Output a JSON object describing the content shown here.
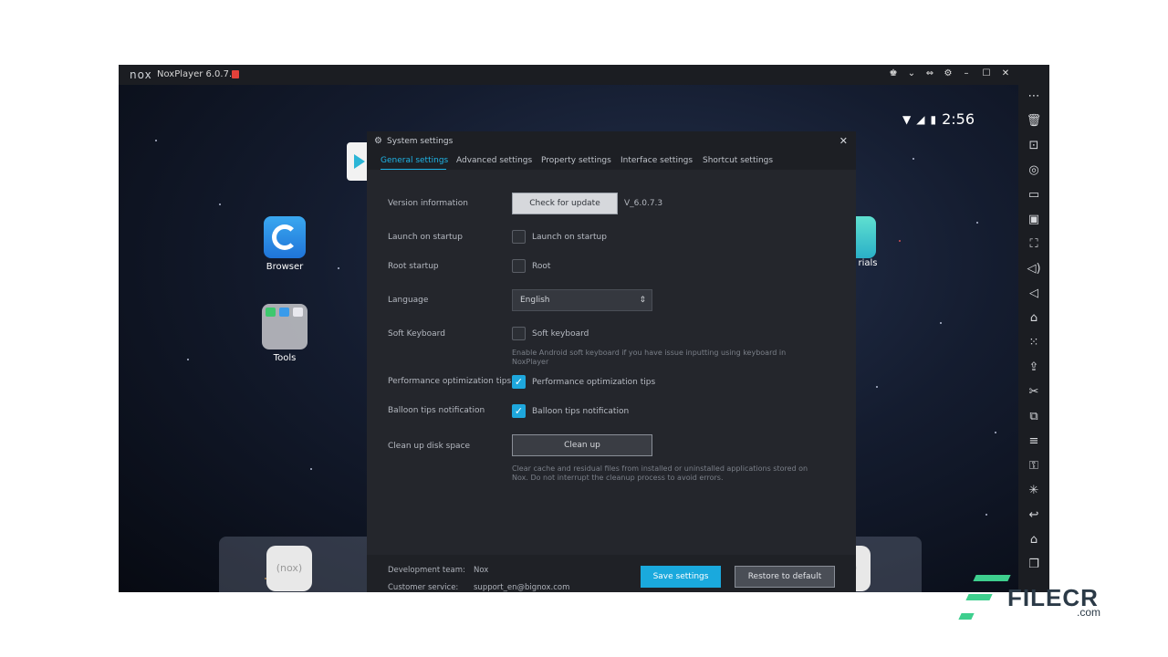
{
  "window": {
    "logo": "nox",
    "title": "NoxPlayer 6.0.7.3",
    "controls": [
      "♚",
      "⌄",
      "⇔",
      "⚙",
      "–",
      "☐",
      "✕"
    ]
  },
  "status_bar": {
    "time": "2:56"
  },
  "home": {
    "apps": [
      {
        "label": "Browser"
      },
      {
        "label": "Tools"
      },
      {
        "label": "rials"
      }
    ],
    "dock": {
      "nox_label": "(nox)"
    }
  },
  "dialog": {
    "title": "System settings",
    "tabs": [
      "General settings",
      "Advanced settings",
      "Property settings",
      "Interface settings",
      "Shortcut settings"
    ],
    "active_tab": "General settings",
    "rows": {
      "version": {
        "label": "Version information",
        "button": "Check for update",
        "value": "V_6.0.7.3"
      },
      "launch": {
        "label": "Launch on startup",
        "checkbox": "Launch on startup",
        "checked": false
      },
      "root": {
        "label": "Root startup",
        "checkbox": "Root",
        "checked": false
      },
      "language": {
        "label": "Language",
        "value": "English"
      },
      "keyboard": {
        "label": "Soft Keyboard",
        "checkbox": "Soft keyboard",
        "checked": false,
        "hint": "Enable Android soft keyboard if you have issue inputting using keyboard in NoxPlayer"
      },
      "perf": {
        "label": "Performance optimization tips",
        "checkbox": "Performance optimization tips",
        "checked": true
      },
      "balloon": {
        "label": "Balloon tips notification",
        "checkbox": "Balloon tips notification",
        "checked": true
      },
      "cleanup": {
        "label": "Clean up disk space",
        "button": "Clean up",
        "hint": "Clear cache and residual files from installed or uninstalled applications stored on Nox. Do not interrupt the cleanup process to avoid errors."
      }
    },
    "footer": {
      "dev_label": "Development team:",
      "dev_value": "Nox",
      "support_label": "Customer service:",
      "support_value": "support_en@bignox.com",
      "save": "Save settings",
      "restore": "Restore to default"
    }
  },
  "sidebar_icons": [
    "more-icon",
    "trash-icon",
    "robot-icon",
    "location-icon",
    "screen-icon",
    "apk-icon",
    "fullscreen-icon",
    "volume-up-icon",
    "volume-down-icon",
    "toolbox-icon",
    "shake-icon",
    "upload-icon",
    "scissors-icon",
    "multi-instance-icon",
    "menu-icon",
    "key-icon",
    "loading-icon",
    "back-icon",
    "home-icon",
    "recent-icon"
  ],
  "watermark": {
    "word": "FILECR",
    "suffix": ".com"
  }
}
